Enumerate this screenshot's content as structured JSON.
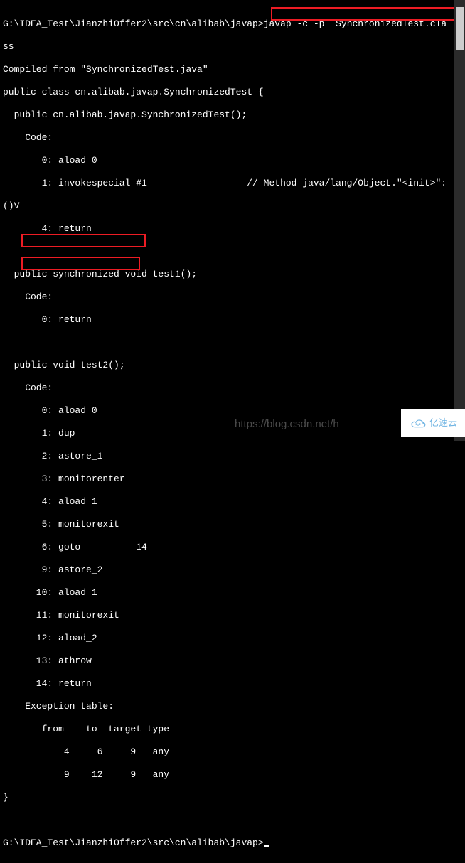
{
  "prompt_path": "G:\\IDEA_Test\\JianzhiOffer2\\src\\cn\\alibab\\javap>",
  "command": "javap -c -p  SynchronizedTest.cla",
  "command_wrap": "ss",
  "output": {
    "compiled_from": "Compiled from \"SynchronizedTest.java\"",
    "class_decl": "public class cn.alibab.javap.SynchronizedTest {",
    "ctor_sig": "  public cn.alibab.javap.SynchronizedTest();",
    "ctor_code_label": "    Code:",
    "ctor_l0": "       0: aload_0",
    "ctor_l1": "       1: invokespecial #1                  // Method java/lang/Object.\"<init>\":",
    "ctor_l1_wrap": "()V",
    "ctor_l4": "       4: return",
    "blank": "",
    "test1_sig": "  public synchronized void test1();",
    "test1_code_label": "    Code:",
    "test1_l0": "       0: return",
    "test2_sig": "  public void test2();",
    "test2_code_label": "    Code:",
    "test2_l0": "       0: aload_0",
    "test2_l1": "       1: dup",
    "test2_l2": "       2: astore_1",
    "test2_l3": "       3: monitorenter",
    "test2_l4": "       4: aload_1",
    "test2_l5": "       5: monitorexit",
    "test2_l6": "       6: goto          14",
    "test2_l9": "       9: astore_2",
    "test2_l10": "      10: aload_1",
    "test2_l11": "      11: monitorexit",
    "test2_l12": "      12: aload_2",
    "test2_l13": "      13: athrow",
    "test2_l14": "      14: return",
    "exc_table": "    Exception table:",
    "exc_header": "       from    to  target type",
    "exc_row1": "           4     6     9   any",
    "exc_row2": "           9    12     9   any",
    "close_brace": "}"
  },
  "prompt2": "G:\\IDEA_Test\\JianzhiOffer2\\src\\cn\\alibab\\javap>",
  "watermark": "https://blog.csdn.net/h",
  "logo_text": "亿速云"
}
